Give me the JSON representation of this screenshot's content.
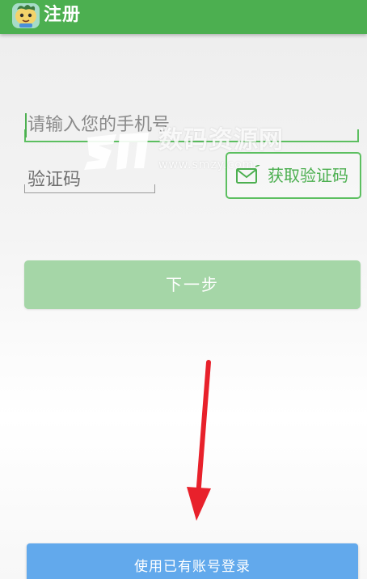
{
  "header": {
    "back_glyph": "〈",
    "title": "注册",
    "app_icon": "cartoon-app-icon",
    "color": "#4caf50"
  },
  "form": {
    "phone_placeholder": "请输入您的手机号",
    "code_placeholder": "验证码",
    "get_code_label": "获取验证码",
    "get_code_icon": "mail-icon",
    "accent": "#4caf50"
  },
  "actions": {
    "next_label": "下一步",
    "next_color": "#a5d6a7",
    "login_label": "使用已有账号登录",
    "login_color": "#62a9ec"
  },
  "annotation": {
    "arrow_color": "#e8212b",
    "arrow_direction": "down"
  },
  "watermark": {
    "text": "数码资源网",
    "url": "www.smzy.com"
  }
}
